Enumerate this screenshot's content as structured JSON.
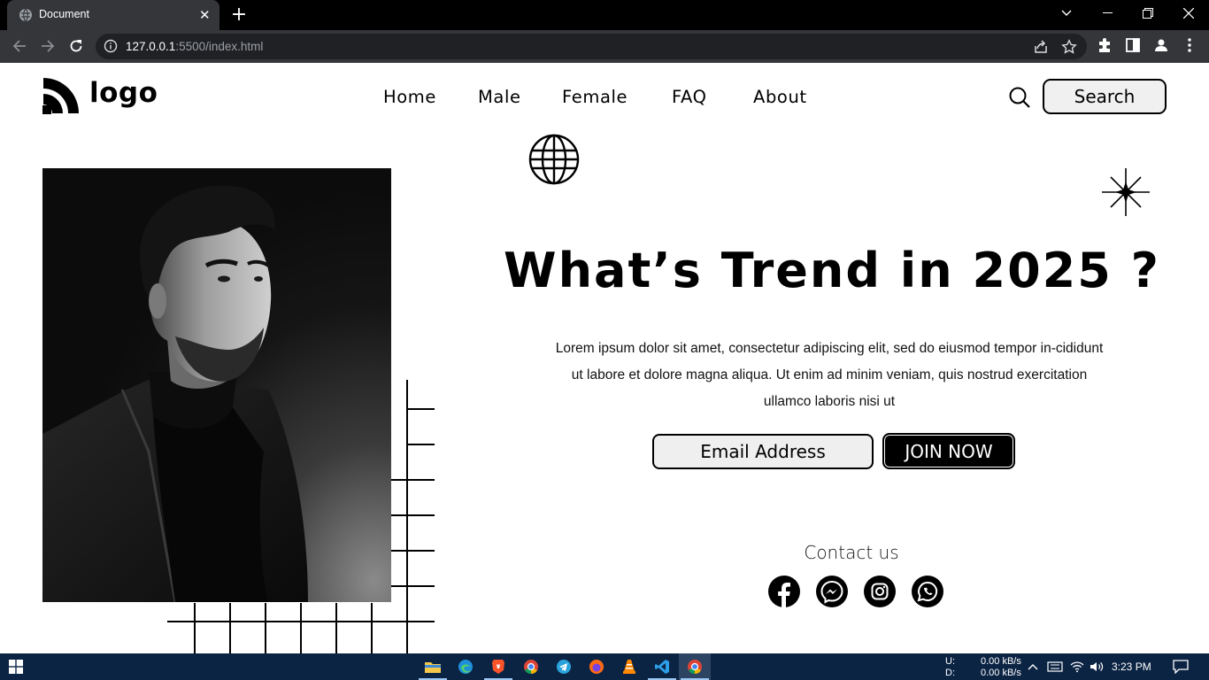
{
  "browser": {
    "tab_title": "Document",
    "url_host": "127.0.0.1",
    "url_rest": ":5500/index.html"
  },
  "site": {
    "logo_text": "logo",
    "nav": [
      "Home",
      "Male",
      "Female",
      "FAQ",
      "About"
    ],
    "search_label": "Search"
  },
  "hero": {
    "title": "What’s Trend in 2025 ?",
    "body": "Lorem ipsum dolor sit amet, consectetur adipiscing elit, sed do eiusmod tempor in-cididunt ut labore et dolore magna aliqua. Ut enim ad minim veniam, quis nostrud exercitation ullamco laboris nisi ut",
    "email_placeholder": "Email Address",
    "cta_label": "JOIN NOW"
  },
  "contact": {
    "title": "Contact us",
    "icons": [
      "facebook-icon",
      "messenger-icon",
      "instagram-icon",
      "whatsapp-icon"
    ]
  },
  "taskbar": {
    "upload_label": "U:",
    "download_label": "D:",
    "upload_speed": "0.00 kB/s",
    "download_speed": "0.00 kB/s",
    "time": "3:23 PM"
  }
}
